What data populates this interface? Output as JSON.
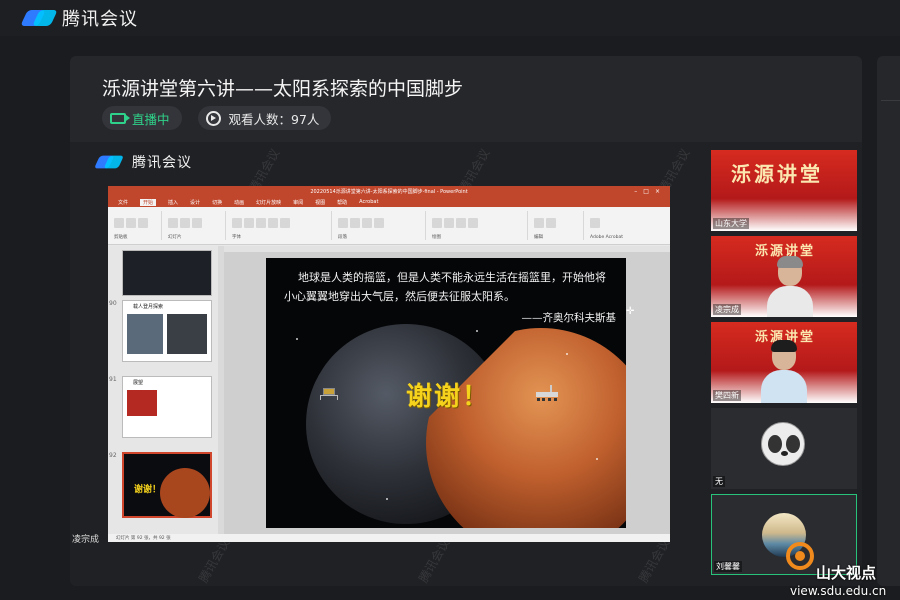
{
  "app": {
    "name": "腾讯会议"
  },
  "meeting": {
    "title": "泺源讲堂第六讲——太阳系探索的中国脚步",
    "live_label": "直播中",
    "viewers_label": "观看人数：97人"
  },
  "stream": {
    "app_name": "腾讯会议",
    "presenter": "凌宗成"
  },
  "ppt": {
    "window_title": "20220514泺源讲堂第六讲-太阳系探索的中国脚步-final - PowerPoint",
    "tabs": [
      "文件",
      "开始",
      "插入",
      "设计",
      "切换",
      "动画",
      "幻灯片放映",
      "审阅",
      "视图",
      "帮助",
      "Acrobat"
    ],
    "ribbon_groups": [
      "剪贴板",
      "幻灯片",
      "字体",
      "段落",
      "绘图",
      "编辑",
      "Adobe Acrobat"
    ],
    "thumb_numbers": [
      "90",
      "91",
      "92"
    ],
    "thumb_titles": [
      "载人登月探索",
      "展望",
      "谢谢！"
    ],
    "status": "幻灯片 第 92 张，共 92 张"
  },
  "slide": {
    "quote": "地球是人类的摇篮，但是人类不能永远生活在摇篮里，开始他将小心翼翼地穿出大气层，然后便去征服太阳系。",
    "author": "——齐奥尔科夫斯基",
    "thanks": "谢谢！"
  },
  "participants": [
    {
      "name": "山东大学",
      "banner": "泺源讲堂"
    },
    {
      "name": "凌宗成",
      "banner": "泺源讲堂"
    },
    {
      "name": "樊四新",
      "banner": "泺源讲堂"
    },
    {
      "name": "无"
    },
    {
      "name": "刘馨馨"
    }
  ],
  "watermark": {
    "brand": "山大视点",
    "url": "view.sdu.edu.cn"
  },
  "colors": {
    "accent_green": "#2fd28a",
    "ppt_red": "#c0462c",
    "banner_red": "#d62b1f"
  }
}
